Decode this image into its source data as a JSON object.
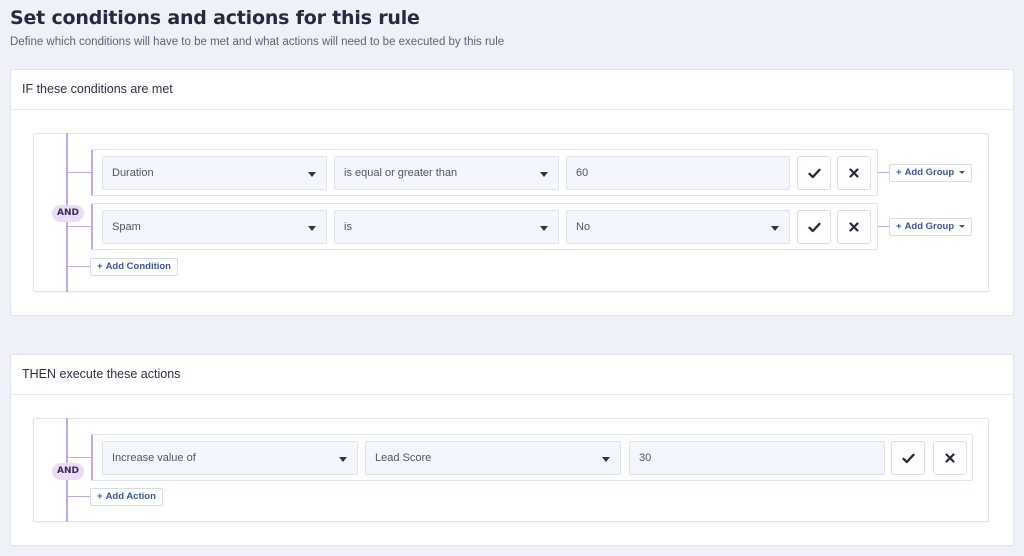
{
  "header": {
    "title": "Set conditions and actions for this rule",
    "subtitle": "Define which conditions will have to be met and what actions will need to be executed by this rule"
  },
  "conditions": {
    "title": "IF these conditions are met",
    "operator": "AND",
    "rows": [
      {
        "field": "Duration",
        "comparator": "is equal or greater than",
        "value": "60",
        "value_has_dropdown": false
      },
      {
        "field": "Spam",
        "comparator": "is",
        "value": "No",
        "value_has_dropdown": true
      }
    ],
    "add_group_label": "Add Group",
    "add_condition_label": "Add Condition"
  },
  "actions": {
    "title": "THEN execute these actions",
    "operator": "AND",
    "rows": [
      {
        "action": "Increase value of",
        "target": "Lead Score",
        "value": "30"
      }
    ],
    "add_action_label": "Add Action"
  },
  "icons": {
    "confirm": "check-icon",
    "remove": "close-icon",
    "add": "plus-icon",
    "dropdown": "chevron-down-icon"
  },
  "colors": {
    "background": "#eef2f8",
    "accent_purple": "#c5a8e8",
    "badge_bg": "#ecdcf8",
    "link_blue": "#3f5597"
  }
}
